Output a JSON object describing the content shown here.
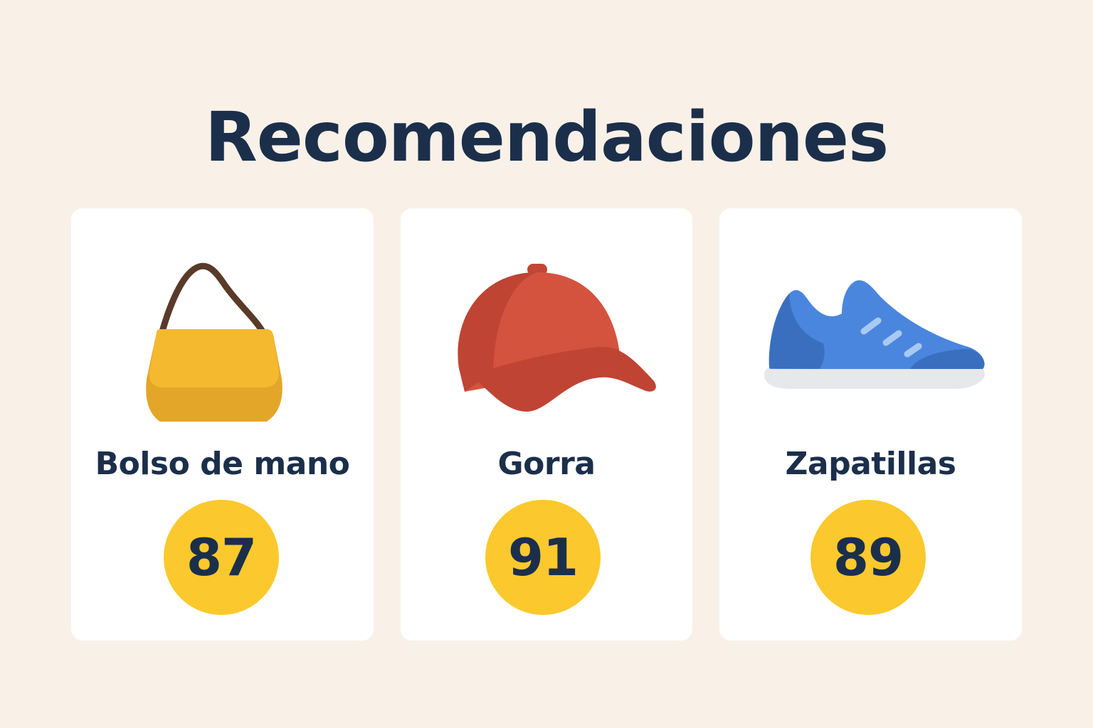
{
  "header": {
    "title": "Recomendaciones"
  },
  "colors": {
    "background": "#f9f1e8",
    "card": "#ffffff",
    "text": "#1b2f4b",
    "badge": "#fbc92d",
    "bag": "#f4b92f",
    "cap": "#d4533e",
    "sneaker": "#4a86dd"
  },
  "recommendations": [
    {
      "name": "Bolso de mano",
      "score": "87",
      "icon": "handbag-icon"
    },
    {
      "name": "Gorra",
      "score": "91",
      "icon": "cap-icon"
    },
    {
      "name": "Zapatillas",
      "score": "89",
      "icon": "sneaker-icon"
    }
  ]
}
